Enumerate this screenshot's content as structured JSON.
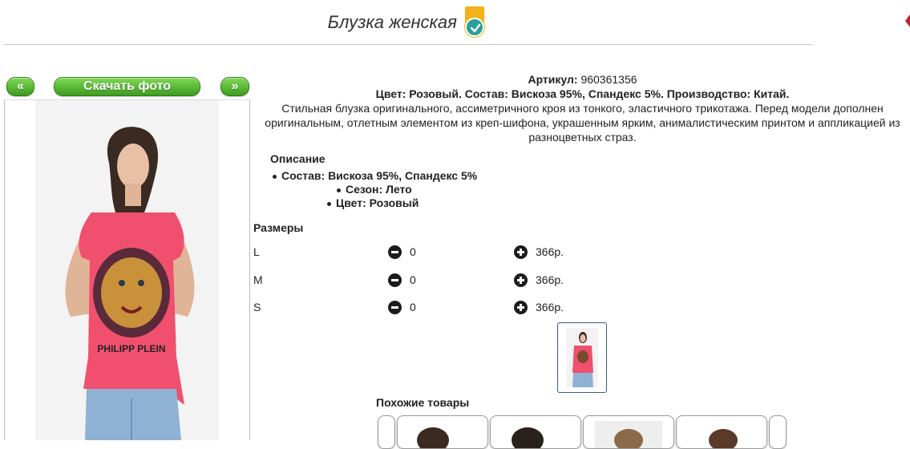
{
  "header": {
    "title": "Блузка женская",
    "badge_icon": "verified-check-icon"
  },
  "gallery": {
    "prev_label": "«",
    "download_label": "Скачать фото",
    "next_label": "»",
    "button_color": "#4caf2a"
  },
  "product": {
    "article_label": "Артикул:",
    "article_value": "960361356",
    "summary": "Цвет: Розовый. Состав: Вискоза 95%, Спандекс 5%. Производство: Китай.",
    "description": "Стильная блузка оригинального, ассиметричного кроя из тонкого, эластичного трикотажа. Перед модели дополнен оригинальным, отлетным элементом из креп-шифона, украшенным ярким, анималистическим принтом и аппликацией из разноцветных страз.",
    "description_heading": "Описание",
    "specs": [
      "Состав: Вискоза 95%, Спандекс 5%",
      "Сезон: Лето",
      "Цвет: Розовый"
    ],
    "shirt_print": "PHILIPP PLEIN"
  },
  "sizes": {
    "heading": "Размеры",
    "rows": [
      {
        "size": "L",
        "qty": "0",
        "price": "366р."
      },
      {
        "size": "M",
        "qty": "0",
        "price": "366р."
      },
      {
        "size": "S",
        "qty": "0",
        "price": "366р."
      }
    ]
  },
  "similar": {
    "heading": "Похожие товары"
  },
  "colors": {
    "shirt": "#f0506e",
    "jeans": "#8fb1d4",
    "accent_green": "#4caf2a"
  }
}
